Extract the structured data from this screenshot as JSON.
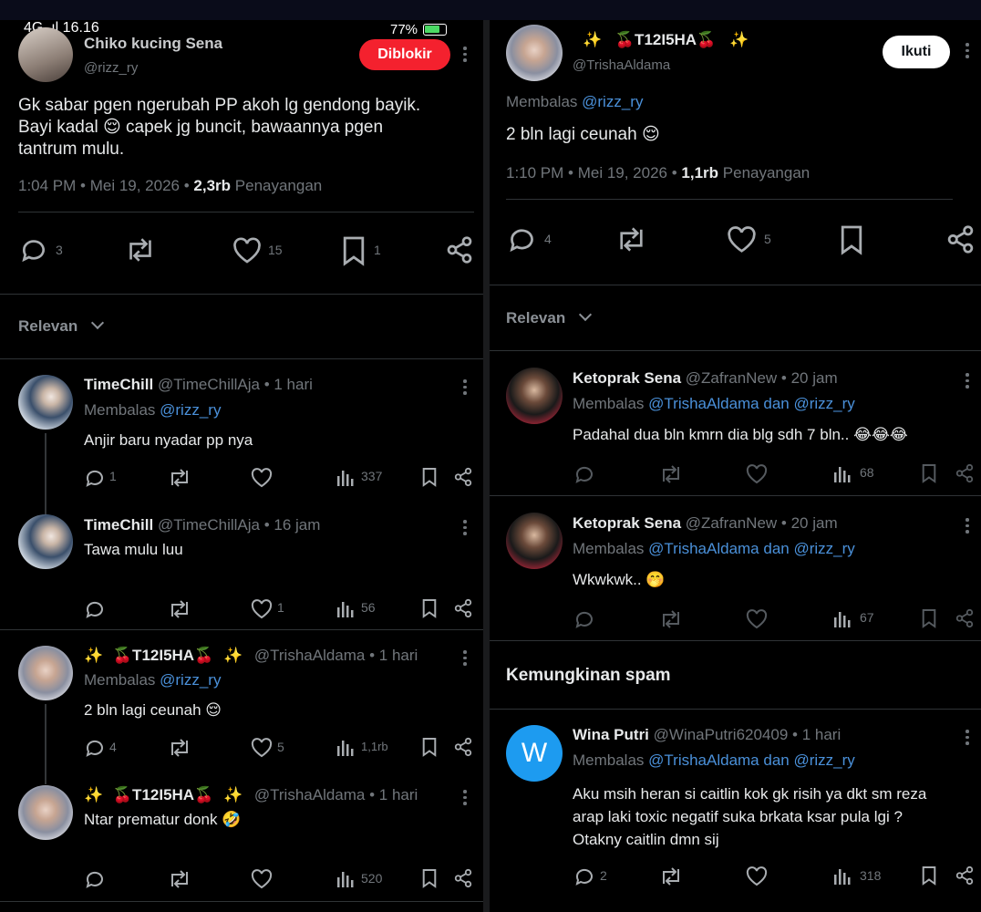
{
  "status_bar": {
    "left": "4G .ıl 16.16",
    "battery": "77%"
  },
  "left": {
    "main_tweet": {
      "name": "Chiko kucing Sena",
      "handle": "@rizz_ry",
      "blocked_label": "Diblokir",
      "text_lines": [
        "Gk sabar pgen ngerubah PP akoh lg gendong bayik.",
        "Bayi kadal 😌 capek jg buncit, bawaannya pgen",
        "tantrum mulu."
      ],
      "time": "1:04 PM • Mei 19, 2026 • ",
      "views": "2,3rb",
      "views_label": " Penayangan",
      "replies": "3",
      "likes": "15",
      "bookmarks": "1"
    },
    "sort_label": "Relevan",
    "replies": [
      {
        "name": "TimeChill",
        "meta": "@TimeChillAja • 1 hari",
        "reply_prefix": "Membalas ",
        "reply_to": "@rizz_ry",
        "text": "Anjir baru nyadar pp nya",
        "replies": "1",
        "likes": "",
        "views": "337"
      },
      {
        "name": "TimeChill",
        "meta": "@TimeChillAja • 16 jam",
        "text": "Tawa mulu luu",
        "replies": "",
        "likes": "1",
        "views": "56"
      },
      {
        "name": "✨ 🍒T12I5HA🍒 ✨",
        "meta": "@TrishaAldama • 1 hari",
        "reply_prefix": "Membalas ",
        "reply_to": "@rizz_ry",
        "text": "2 bln lagi ceunah 😌",
        "replies": "4",
        "likes": "5",
        "views": "1,1rb"
      },
      {
        "name": "✨ 🍒T12I5HA🍒 ✨",
        "meta": "@TrishaAldama • 1 hari",
        "text": "Ntar prematur donk 🤣",
        "replies": "",
        "likes": "",
        "views": "520"
      }
    ]
  },
  "right": {
    "main_tweet": {
      "name": "✨ 🍒T12I5HA🍒 ✨",
      "handle": "@TrishaAldama",
      "follow_label": "Ikuti",
      "reply_prefix": "Membalas ",
      "reply_to": "@rizz_ry",
      "text": "2 bln lagi ceunah 😌",
      "time": "1:10 PM • Mei 19, 2026 • ",
      "views": "1,1rb",
      "views_label": " Penayangan",
      "replies": "4",
      "likes": "5"
    },
    "sort_label": "Relevan",
    "replies": [
      {
        "name": "Ketoprak Sena",
        "meta": "@ZafranNew • 20 jam",
        "reply_prefix": "Membalas ",
        "reply_to": "@TrishaAldama dan @rizz_ry",
        "text": "Padahal dua bln kmrn dia blg sdh 7 bln.. 😂😂😂",
        "views": "68"
      },
      {
        "name": "Ketoprak Sena",
        "meta": "@ZafranNew • 20 jam",
        "reply_prefix": "Membalas ",
        "reply_to": "@TrishaAldama dan @rizz_ry",
        "text": "Wkwkwk.. 🤭",
        "views": "67"
      }
    ],
    "spam_section": {
      "title": "Kemungkinan spam",
      "reply": {
        "avatar_letter": "W",
        "name": "Wina Putri",
        "meta": "@WinaPutri620409 • 1 hari",
        "reply_prefix": "Membalas ",
        "reply_to": "@TrishaAldama dan @rizz_ry",
        "text_lines": [
          "Aku msih heran si caitlin kok gk risih ya dkt sm reza",
          "arap laki toxic negatif suka brkata ksar pula lgi ?",
          "Otakny caitlin dmn sij"
        ],
        "replies": "2",
        "views": "318"
      }
    }
  },
  "colors": {
    "accent_link": "#4a90d9",
    "blocked": "#f4212e",
    "text_gray": "#71767b",
    "avatar_w": "#1d9bf0"
  }
}
